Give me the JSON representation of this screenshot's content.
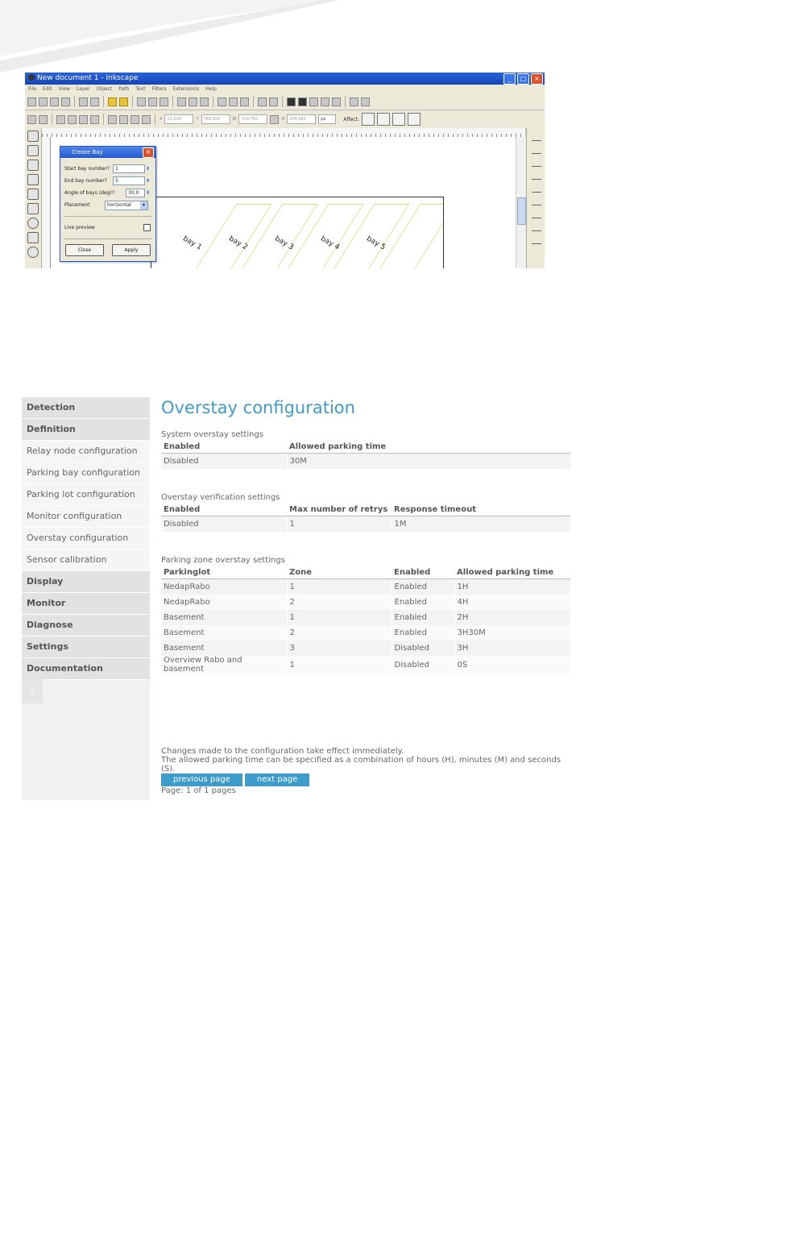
{
  "inkscape": {
    "window_title": "New document 1 - Inkscape",
    "menu": [
      "File",
      "Edit",
      "View",
      "Layer",
      "Object",
      "Path",
      "Text",
      "Filters",
      "Extensions",
      "Help"
    ],
    "toolbar2": {
      "x": "13,234",
      "y": "789,954",
      "w": "719,750",
      "h": "259,082",
      "unit": "px",
      "affect_label": "Affect:"
    },
    "dialog": {
      "title": "Create Bay",
      "start_label": "Start bay number?",
      "start_value": "1",
      "end_label": "End bay number?",
      "end_value": "5",
      "angle_label": "Angle of bays (deg)?",
      "angle_value": "30,0",
      "placement_label": "Placement",
      "placement_value": "horizontal",
      "live_preview_label": "Live preview",
      "close_label": "Close",
      "apply_label": "Apply"
    },
    "bays": [
      "bay 1",
      "bay 2",
      "bay 3",
      "bay 4",
      "bay 5"
    ]
  },
  "sidebar": {
    "items": [
      {
        "label": "Detection",
        "type": "header"
      },
      {
        "label": "Definition",
        "type": "header"
      },
      {
        "label": "Relay node configuration",
        "type": "sub"
      },
      {
        "label": "Parking bay configuration",
        "type": "sub"
      },
      {
        "label": "Parking lot configuration",
        "type": "sub"
      },
      {
        "label": "Monitor configuration",
        "type": "sub"
      },
      {
        "label": "Overstay configuration",
        "type": "sub"
      },
      {
        "label": "Sensor calibration",
        "type": "sub"
      },
      {
        "label": "Display",
        "type": "header"
      },
      {
        "label": "Monitor",
        "type": "header"
      },
      {
        "label": "Diagnose",
        "type": "header"
      },
      {
        "label": "Settings",
        "type": "header"
      },
      {
        "label": "Documentation",
        "type": "header"
      }
    ],
    "back_glyph": "‹"
  },
  "main": {
    "title": "Overstay configuration",
    "system": {
      "label": "System overstay settings",
      "headers": [
        "Enabled",
        "Allowed parking time"
      ],
      "rows": [
        [
          "Disabled",
          "30M"
        ]
      ]
    },
    "verification": {
      "label": "Overstay verification settings",
      "headers": [
        "Enabled",
        "Max number of retrys",
        "Response timeout"
      ],
      "rows": [
        [
          "Disabled",
          "1",
          "1M"
        ]
      ]
    },
    "zones": {
      "label": "Parking zone overstay settings",
      "headers": [
        "Parkinglot",
        "Zone",
        "Enabled",
        "Allowed parking time"
      ],
      "rows": [
        [
          "NedapRabo",
          "1",
          "Enabled",
          "1H"
        ],
        [
          "NedapRabo",
          "2",
          "Enabled",
          "4H"
        ],
        [
          "Basement",
          "1",
          "Enabled",
          "2H"
        ],
        [
          "Basement",
          "2",
          "Enabled",
          "3H30M"
        ],
        [
          "Basement",
          "3",
          "Disabled",
          "3H"
        ],
        [
          "Overview Rabo and basement",
          "1",
          "Disabled",
          "0S"
        ]
      ]
    },
    "note1": "Changes made to the configuration take effect immediately.",
    "note2": "The allowed parking time can be specified as a combination of hours (H), minutes (M) and seconds (S).",
    "prev_label": "previous page",
    "next_label": "next page",
    "page_info": "Page: 1 of 1 pages"
  }
}
